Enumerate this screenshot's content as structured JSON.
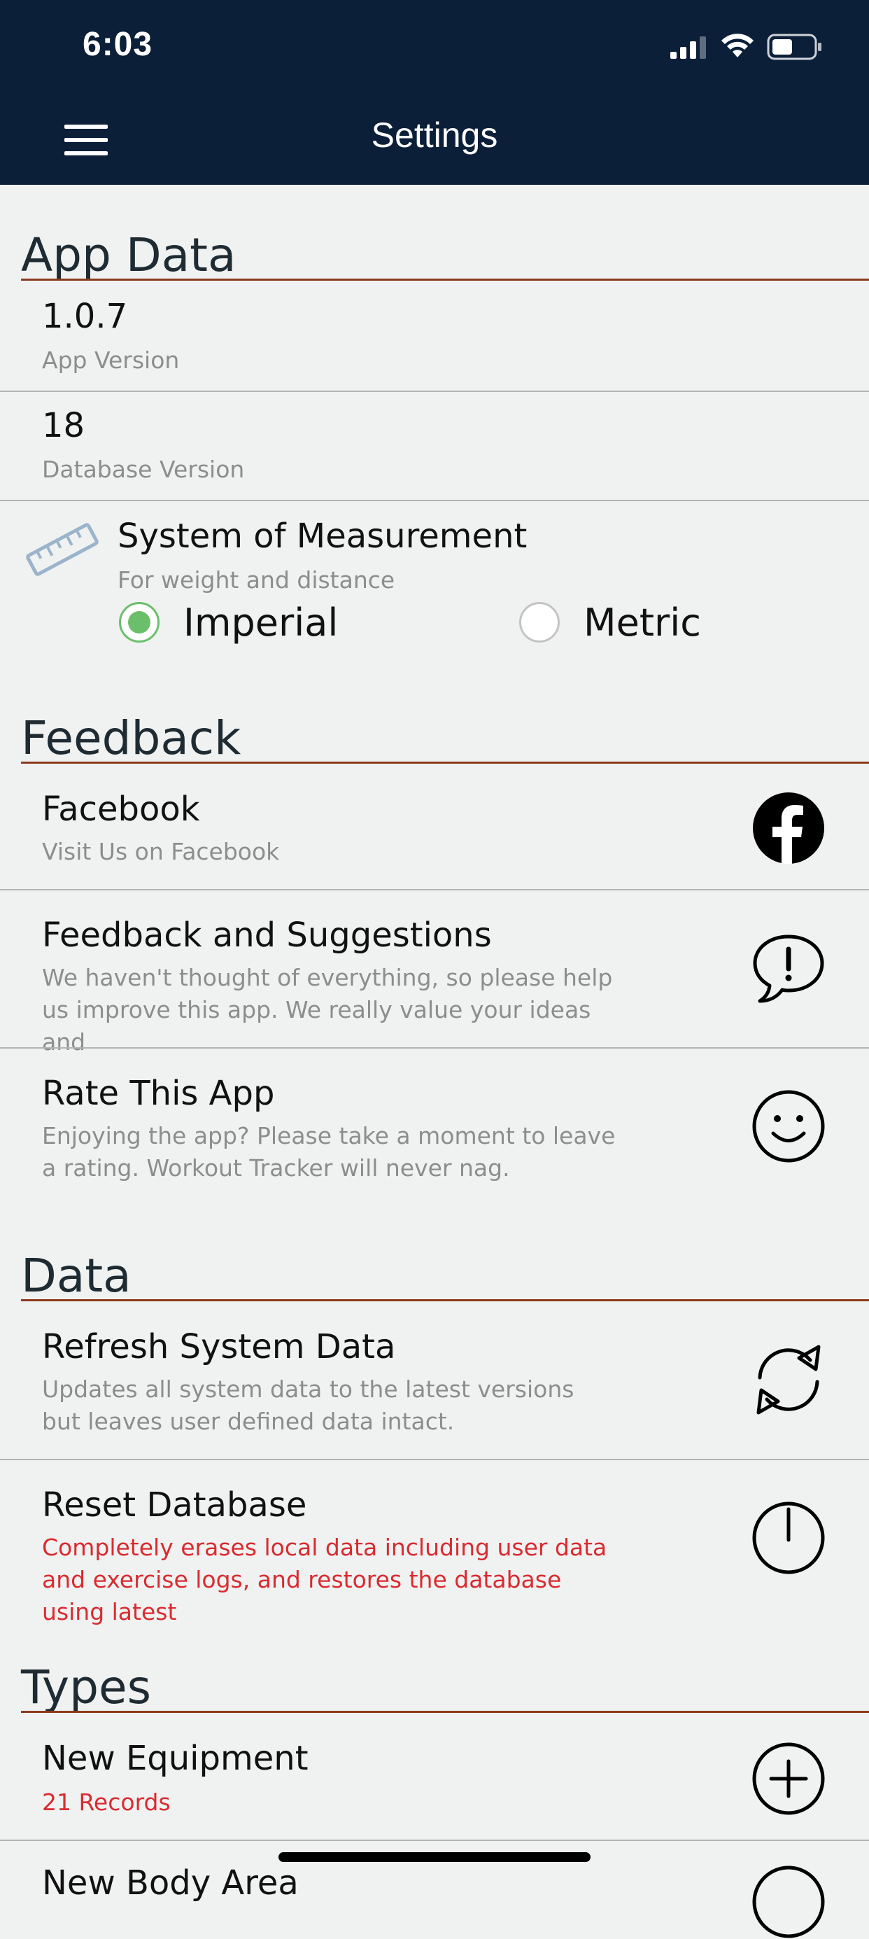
{
  "status_bar": {
    "time": "6:03"
  },
  "nav": {
    "title": "Settings"
  },
  "app_data": {
    "section_title": "App Data",
    "app_version_value": "1.0.7",
    "app_version_label": "App Version",
    "db_version_value": "18",
    "db_version_label": "Database Version",
    "measurement": {
      "title": "System of Measurement",
      "subtitle": "For weight and distance",
      "options": [
        "Imperial",
        "Metric"
      ],
      "selected": "Imperial"
    }
  },
  "feedback": {
    "section_title": "Feedback",
    "facebook_title": "Facebook",
    "facebook_sub": "Visit Us on Facebook",
    "suggestions_title": "Feedback and Suggestions",
    "suggestions_sub": "We haven't thought of everything, so please help us improve this app. We really value your ideas and",
    "rate_title": "Rate This App",
    "rate_sub": "Enjoying the app? Please take a moment to leave a rating. Workout Tracker will never nag."
  },
  "data": {
    "section_title": "Data",
    "refresh_title": "Refresh System Data",
    "refresh_sub": "Updates all system data to the latest versions but leaves user defined data intact.",
    "reset_title": "Reset Database",
    "reset_sub": "Completely erases local data including user data and exercise logs, and restores the database using latest"
  },
  "types": {
    "section_title": "Types",
    "equipment_title": "New Equipment",
    "equipment_sub": "21 Records",
    "body_area_title": "New Body Area"
  },
  "colors": {
    "header_bg": "#0c1f39",
    "page_bg": "#f0f2f1",
    "section_rule": "#8b3a1c",
    "accent_green": "#6bbf6b",
    "warning_red": "#d92b30"
  }
}
